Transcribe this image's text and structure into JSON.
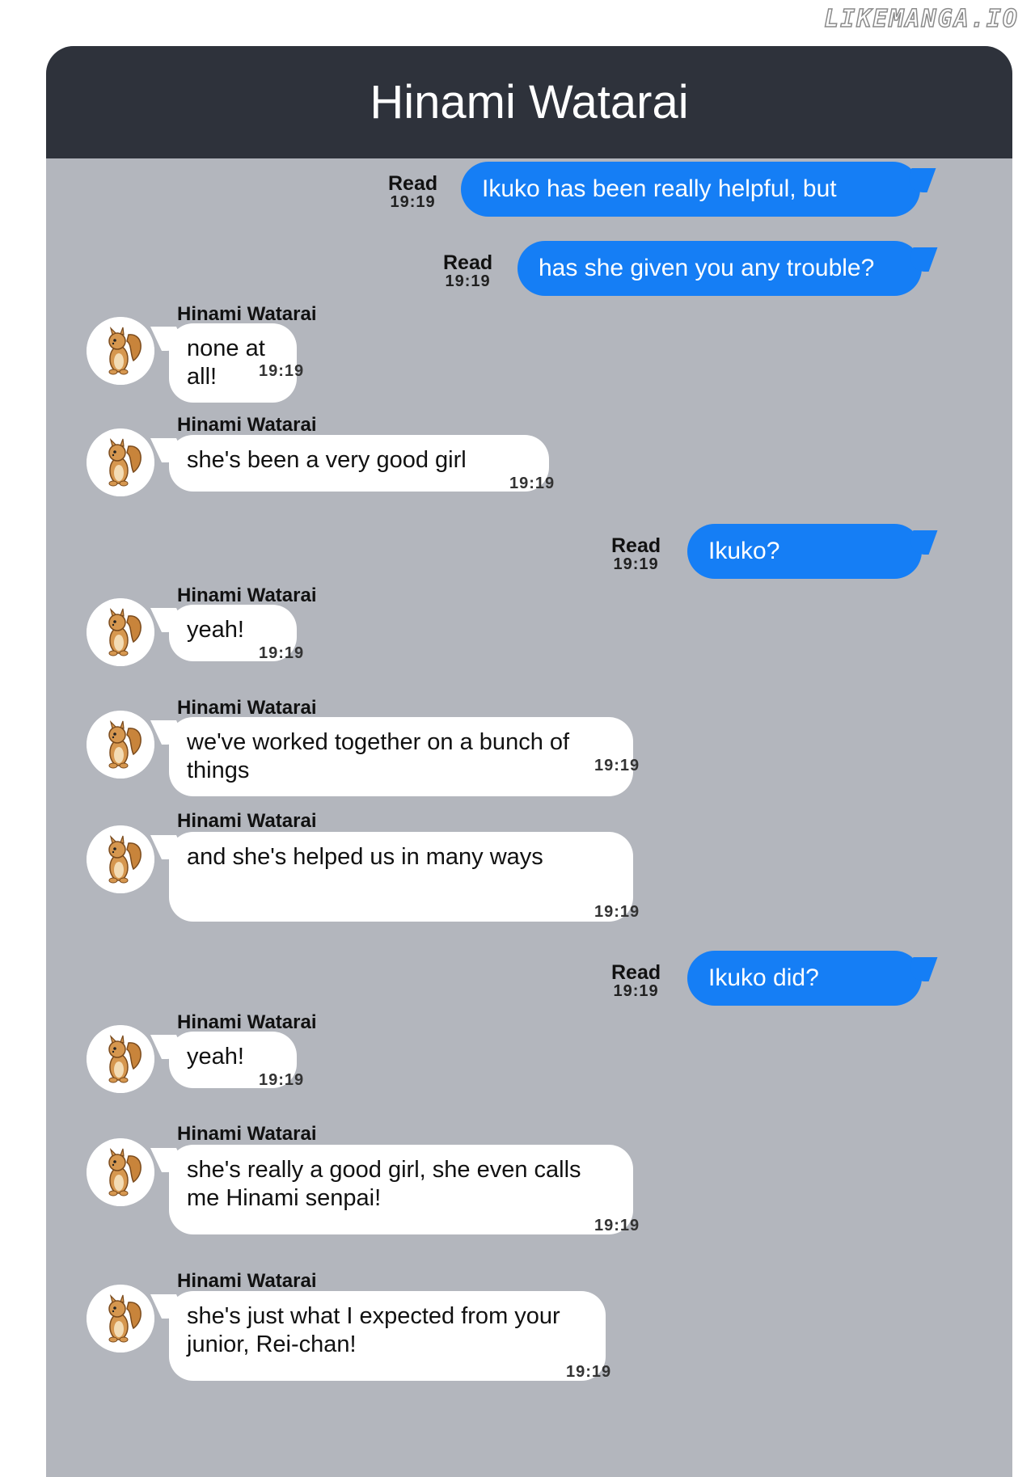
{
  "watermark": "LIKEMANGA.IO",
  "header": {
    "title": "Hinami Watarai"
  },
  "messages": [
    {
      "dir": "out",
      "text": "Ikuko has been really helpful, but",
      "status": "Read",
      "time": "19:19"
    },
    {
      "dir": "out",
      "text": "has she given you any trouble?",
      "status": "Read",
      "time": "19:19"
    },
    {
      "dir": "in",
      "sender": "Hinami Watarai",
      "text": "none at all!",
      "time": "19:19"
    },
    {
      "dir": "in",
      "sender": "Hinami Watarai",
      "text": "she's been a very good girl",
      "time": "19:19"
    },
    {
      "dir": "out",
      "text": "Ikuko?",
      "status": "Read",
      "time": "19:19"
    },
    {
      "dir": "in",
      "sender": "Hinami Watarai",
      "text": "yeah!",
      "time": "19:19"
    },
    {
      "dir": "in",
      "sender": "Hinami Watarai",
      "text": "we've worked together on a bunch of things",
      "time": "19:19"
    },
    {
      "dir": "in",
      "sender": "Hinami Watarai",
      "text": "and she's helped us in many ways",
      "time": "19:19"
    },
    {
      "dir": "out",
      "text": "Ikuko did?",
      "status": "Read",
      "time": "19:19"
    },
    {
      "dir": "in",
      "sender": "Hinami Watarai",
      "text": "yeah!",
      "time": "19:19"
    },
    {
      "dir": "in",
      "sender": "Hinami Watarai",
      "text": "she's really a good girl, she even calls me Hinami senpai!",
      "time": "19:19"
    },
    {
      "dir": "in",
      "sender": "Hinami Watarai",
      "text": "she's just what I expected from your junior, Rei-chan!",
      "time": "19:19"
    }
  ],
  "avatar_icon": "squirrel-icon"
}
